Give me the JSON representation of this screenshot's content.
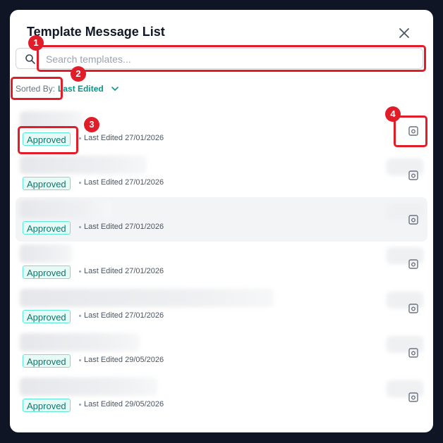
{
  "modal": {
    "title": "Template Message List"
  },
  "search": {
    "placeholder": "Search templates..."
  },
  "sort": {
    "label": "Sorted By:",
    "value": "Last Edited"
  },
  "templates": [
    {
      "status": "Approved",
      "edited": "Last Edited 27/01/2026"
    },
    {
      "status": "Approved",
      "edited": "Last Edited 27/01/2026"
    },
    {
      "status": "Approved",
      "edited": "Last Edited 27/01/2026"
    },
    {
      "status": "Approved",
      "edited": "Last Edited 27/01/2026"
    },
    {
      "status": "Approved",
      "edited": "Last Edited 27/01/2026"
    },
    {
      "status": "Approved",
      "edited": "Last Edited 29/05/2026"
    },
    {
      "status": "Approved",
      "edited": "Last Edited 29/05/2026"
    }
  ],
  "annotations": [
    "1",
    "2",
    "3",
    "4"
  ],
  "icons": {
    "close": "close-icon",
    "search": "search-icon",
    "sort": "chevron-down-icon",
    "copy": "copy-icon"
  },
  "colors": {
    "accent": "#0d9488",
    "badge_border": "#5eead4",
    "badge_bg": "#e6fbf6",
    "annotation": "#e11d2a"
  }
}
